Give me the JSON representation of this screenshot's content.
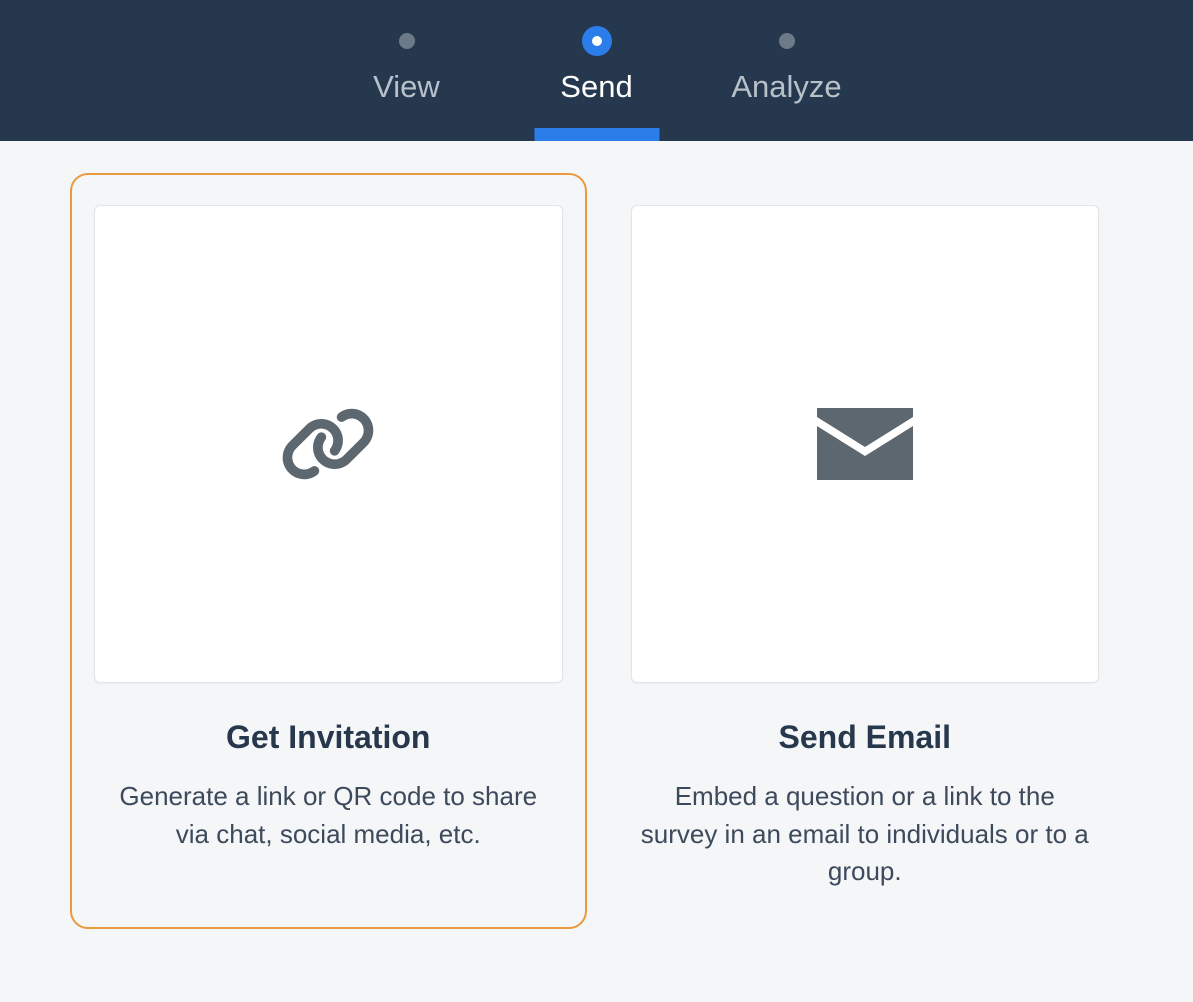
{
  "tabs": [
    {
      "label": "View",
      "active": false
    },
    {
      "label": "Send",
      "active": true
    },
    {
      "label": "Analyze",
      "active": false
    }
  ],
  "cards": [
    {
      "title": "Get Invitation",
      "description": "Generate a link or QR code to share via chat, social media, etc.",
      "selected": true,
      "icon": "link-icon"
    },
    {
      "title": "Send Email",
      "description": "Embed a question or a link to the survey in an email to individuals or to a group.",
      "selected": false,
      "icon": "envelope-icon"
    }
  ]
}
